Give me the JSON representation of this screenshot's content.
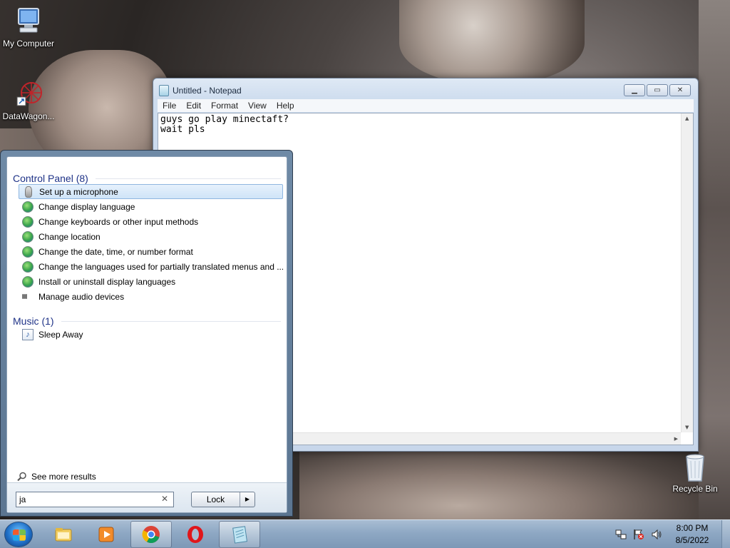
{
  "desktop": {
    "icons": [
      {
        "label": "My Computer"
      },
      {
        "label": "DataWagon..."
      },
      {
        "label": "Recycle Bin"
      }
    ]
  },
  "notepad": {
    "title": "Untitled - Notepad",
    "menu": [
      "File",
      "Edit",
      "Format",
      "View",
      "Help"
    ],
    "content": "guys go play minectaft?\nwait pls"
  },
  "start_menu": {
    "groups": [
      {
        "title": "Control Panel (8)",
        "items": [
          {
            "label": "Set up a microphone",
            "icon": "microphone-icon",
            "selected": true
          },
          {
            "label": "Change display language",
            "icon": "control-panel-icon"
          },
          {
            "label": "Change keyboards or other input methods",
            "icon": "control-panel-icon"
          },
          {
            "label": "Change location",
            "icon": "control-panel-icon"
          },
          {
            "label": "Change the date, time, or number format",
            "icon": "control-panel-icon"
          },
          {
            "label": "Change the languages used for partially translated menus and ...",
            "icon": "control-panel-icon"
          },
          {
            "label": "Install or uninstall display languages",
            "icon": "control-panel-icon"
          },
          {
            "label": "Manage audio devices",
            "icon": "speaker-icon"
          }
        ]
      },
      {
        "title": "Music (1)",
        "items": [
          {
            "label": "Sleep Away",
            "icon": "music-file-icon"
          }
        ]
      }
    ],
    "see_more": "See more results",
    "search_value": "ja",
    "lock_label": "Lock"
  },
  "taskbar": {
    "pinned": [
      "windows-explorer-icon",
      "media-player-icon",
      "chrome-icon",
      "opera-icon",
      "notepad-icon"
    ],
    "clock_time": "8:00 PM",
    "clock_date": "8/5/2022"
  },
  "colors": {
    "accent": "#1e3287",
    "selection": "#cfe4f8",
    "taskbar": "#8ea8c4"
  }
}
